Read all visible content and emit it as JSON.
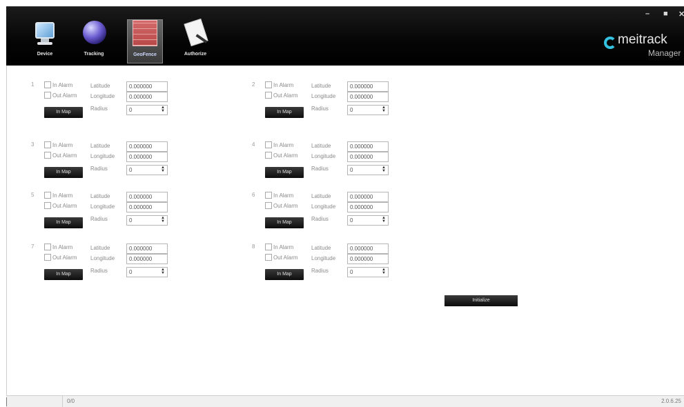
{
  "window_controls": {
    "minimize": "–",
    "maximize": "■",
    "close": "✕"
  },
  "nav": [
    {
      "label": "Device",
      "icon": "monitor-icon"
    },
    {
      "label": "Tracking",
      "icon": "globe-icon"
    },
    {
      "label": "GeoFence",
      "icon": "brick-wall-icon"
    },
    {
      "label": "Authorize",
      "icon": "document-icon"
    }
  ],
  "brand": {
    "name": "meitrack",
    "sub": "Manager",
    "accent": "#35c2e0"
  },
  "fence_labels": {
    "in_alarm": "In Alarm",
    "out_alarm": "Out Alarm",
    "latitude": "Latitude",
    "longitude": "Longitude",
    "radius": "Radius",
    "in_map": "In Map"
  },
  "fences": [
    {
      "num": "1",
      "lat": "0.000000",
      "lng": "0.000000",
      "radius": "0"
    },
    {
      "num": "2",
      "lat": "0.000000",
      "lng": "0.000000",
      "radius": "0"
    },
    {
      "num": "3",
      "lat": "0.000000",
      "lng": "0.000000",
      "radius": "0"
    },
    {
      "num": "4",
      "lat": "0.000000",
      "lng": "0.000000",
      "radius": "0"
    },
    {
      "num": "5",
      "lat": "0.000000",
      "lng": "0.000000",
      "radius": "0"
    },
    {
      "num": "6",
      "lat": "0.000000",
      "lng": "0.000000",
      "radius": "0"
    },
    {
      "num": "7",
      "lat": "0.000000",
      "lng": "0.000000",
      "radius": "0"
    },
    {
      "num": "8",
      "lat": "0.000000",
      "lng": "0.000000",
      "radius": "0"
    }
  ],
  "init_label": "Initialize",
  "status": {
    "progress": "0/0",
    "version": "2.0.6.25"
  }
}
